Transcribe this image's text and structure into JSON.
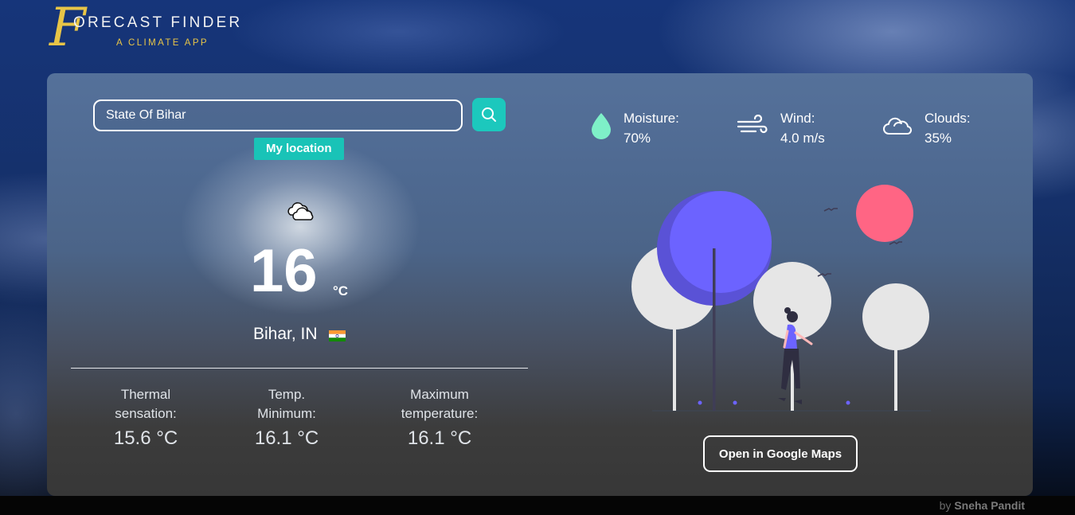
{
  "app": {
    "title": "ORECAST FINDER",
    "subtitle": "A CLIMATE APP",
    "logo_letter": "F"
  },
  "search": {
    "value": "State Of Bihar",
    "button_icon": "search-icon"
  },
  "my_location_label": "My location",
  "current": {
    "condition_icon": "clouds-icon",
    "temperature": "16",
    "unit": "°C",
    "city": "Bihar, IN",
    "flag": "india-flag-icon"
  },
  "stats": [
    {
      "label_line1": "Thermal",
      "label_line2": "sensation:",
      "value": "15.6 °C"
    },
    {
      "label_line1": "Temp.",
      "label_line2": "Minimum:",
      "value": "16.1 °C"
    },
    {
      "label_line1": "Maximum",
      "label_line2": "temperature:",
      "value": "16.1 °C"
    }
  ],
  "details": {
    "moisture": {
      "label": "Moisture:",
      "value": "70%",
      "icon": "water-drop-icon"
    },
    "wind": {
      "label": "Wind:",
      "value": "4.0 m/s",
      "icon": "wind-icon"
    },
    "clouds": {
      "label": "Clouds:",
      "value": "35%",
      "icon": "cloud-icon"
    }
  },
  "maps_button_label": "Open in Google Maps",
  "credit": {
    "prefix": "by ",
    "author": "Sneha Pandit"
  },
  "colors": {
    "accent": "#1cc8bd",
    "logo_gold": "#e8c547",
    "moisture_drop": "#7ef0c8",
    "tree_purple": "#6c63ff",
    "sun_pink": "#ff6584"
  }
}
